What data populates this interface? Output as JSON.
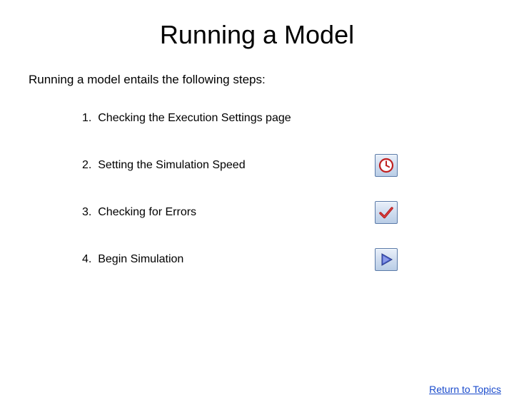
{
  "title": "Running a Model",
  "intro": "Running a model entails the following steps:",
  "steps": [
    {
      "num": "1.",
      "text": "Checking the Execution Settings page",
      "icon": null
    },
    {
      "num": "2.",
      "text": "Setting the Simulation Speed",
      "icon": "clock"
    },
    {
      "num": "3.",
      "text": "Checking for Errors",
      "icon": "check"
    },
    {
      "num": "4.",
      "text": "Begin Simulation",
      "icon": "play"
    }
  ],
  "return_link": "Return to Topics"
}
